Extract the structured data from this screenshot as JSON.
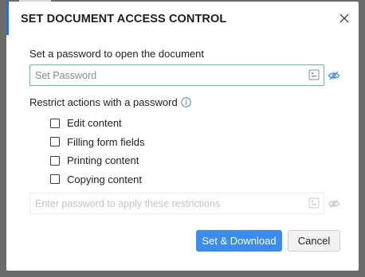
{
  "dialog": {
    "title": "SET DOCUMENT ACCESS CONTROL",
    "open_password_label": "Set a password to open the document",
    "open_password_placeholder": "Set Password",
    "open_password_value": "",
    "restrict_label": "Restrict actions with a password",
    "restrictions": [
      {
        "label": "Edit content",
        "checked": false
      },
      {
        "label": "Filling form fields",
        "checked": false
      },
      {
        "label": "Printing content",
        "checked": false
      },
      {
        "label": "Copying content",
        "checked": false
      }
    ],
    "restrict_password_placeholder": "Enter password to apply these restrictions",
    "restrict_password_value": "",
    "primary_button": "Set & Download",
    "cancel_button": "Cancel"
  },
  "icons": {
    "close": "close-icon",
    "info": "info-icon",
    "keypad": "keypad-icon",
    "visibility": "eye-slash-icon"
  },
  "colors": {
    "accent": "#1a73e8",
    "primary_button": "#3b8cf0",
    "input_focus_border": "#66b7a4",
    "info_icon": "#3a8be0"
  }
}
